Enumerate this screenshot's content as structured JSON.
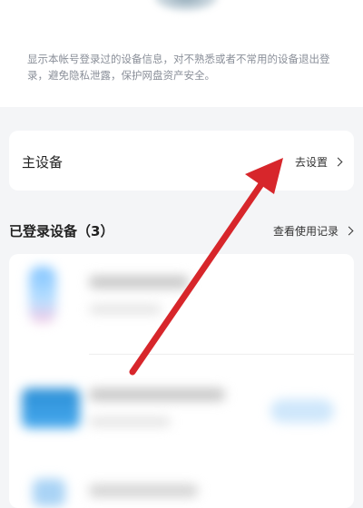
{
  "description": {
    "text": "显示本帐号登录过的设备信息，对不熟悉或者不常用的设备退出登录，避免隐私泄露，保护网盘资产安全。"
  },
  "main_device": {
    "title": "主设备",
    "action_label": "去设置"
  },
  "logged_devices": {
    "title": "已登录设备（3）",
    "action_label": "查看使用记录"
  },
  "colors": {
    "annotation_arrow": "#d7262b",
    "page_background": "#f4f5f7"
  },
  "icons": {
    "chevron": "chevron-right-icon"
  }
}
